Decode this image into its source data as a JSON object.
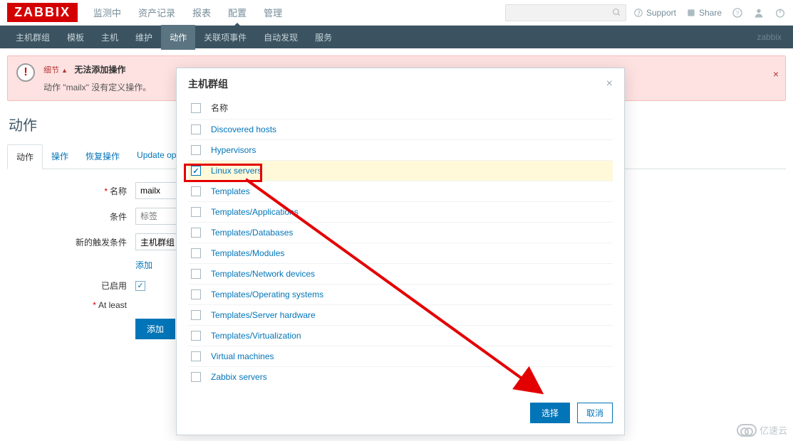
{
  "logo": "ZABBIX",
  "topnav": [
    "监测中",
    "资产记录",
    "报表",
    "配置",
    "管理"
  ],
  "topnav_active": 3,
  "topright": {
    "support": "Support",
    "share": "Share"
  },
  "subnav": [
    "主机群组",
    "模板",
    "主机",
    "维护",
    "动作",
    "关联项事件",
    "自动发现",
    "服务"
  ],
  "subnav_active": 4,
  "subnav_brand": "zabbix",
  "alert": {
    "details_label": "细节",
    "title": "无法添加操作",
    "line2": "动作 \"mailx\" 没有定义操作。"
  },
  "page_title": "动作",
  "tabs": [
    "动作",
    "操作",
    "恢复操作",
    "Update operations"
  ],
  "tabs_active": 0,
  "form": {
    "name_label": "名称",
    "name_value": "mailx",
    "cond_label": "条件",
    "cond_placeholder": "标签",
    "newcond_label": "新的触发条件",
    "newcond_value": "主机群组",
    "add_link": "添加",
    "enabled_label": "已启用",
    "atleast": "At least",
    "submit": "添加"
  },
  "modal": {
    "title": "主机群组",
    "header_label": "名称",
    "items": [
      {
        "label": "Discovered hosts",
        "checked": false
      },
      {
        "label": "Hypervisors",
        "checked": false
      },
      {
        "label": "Linux servers",
        "checked": true
      },
      {
        "label": "Templates",
        "checked": false
      },
      {
        "label": "Templates/Applications",
        "checked": false
      },
      {
        "label": "Templates/Databases",
        "checked": false
      },
      {
        "label": "Templates/Modules",
        "checked": false
      },
      {
        "label": "Templates/Network devices",
        "checked": false
      },
      {
        "label": "Templates/Operating systems",
        "checked": false
      },
      {
        "label": "Templates/Server hardware",
        "checked": false
      },
      {
        "label": "Templates/Virtualization",
        "checked": false
      },
      {
        "label": "Virtual machines",
        "checked": false
      },
      {
        "label": "Zabbix servers",
        "checked": false
      }
    ],
    "select_btn": "选择",
    "cancel_btn": "取消"
  },
  "watermark": "亿速云"
}
